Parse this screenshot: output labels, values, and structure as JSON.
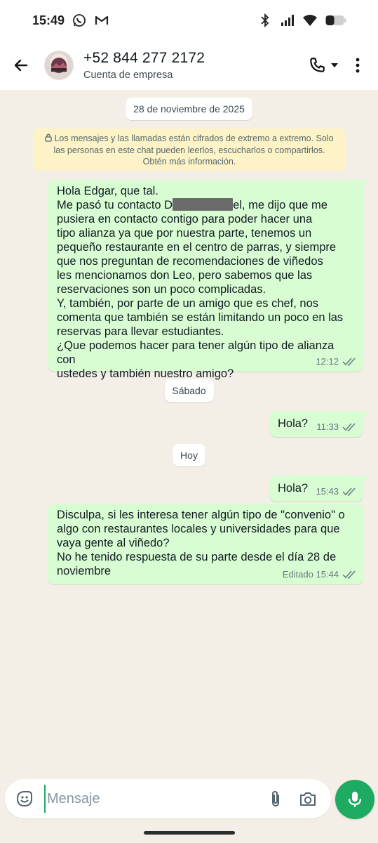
{
  "status_bar": {
    "time": "15:49",
    "left_icons": [
      "whatsapp-icon",
      "gmail-icon"
    ],
    "right_icons": [
      "bluetooth-icon",
      "signal-icon",
      "wifi-icon",
      "battery-icon"
    ]
  },
  "header": {
    "contact_name": "+52 844 277 2172",
    "contact_subtitle": "Cuenta de empresa",
    "icons": [
      "back-arrow-icon",
      "phone-icon",
      "chevron-down-icon",
      "more-vert-icon"
    ]
  },
  "chat": {
    "date_chip": "28 de noviembre de 2025",
    "encryption_notice": "Los mensajes y las llamadas están cifrados de extremo a extremo. Solo las personas en este chat pueden leerlos, escucharlos o compartirlos. Obtén más información.",
    "messages": [
      {
        "text_before": "Hola Edgar, que tal.\nMe pasó tu contacto D",
        "text_after": "el, me dijo que me\npusiera en contacto contigo para poder hacer una\ntipo alianza ya que por nuestra parte, tenemos un\npequeño restaurante en el centro de parras, y siempre\nque nos preguntan de recomendaciones de viñedos\nles mencionamos don Leo, pero sabemos que las\nreservaciones son un poco complicadas.\nY, también, por parte de un amigo que es chef, nos\ncomenta que también se están limitando un poco en las\nreservas para llevar estudiantes.\n¿Que podemos hacer para tener algún tipo de alianza con\nustedes y también nuestro amigo?",
        "time": "12:12",
        "status": "read-ticks"
      },
      {
        "day_chip": "Sábado"
      },
      {
        "text": "Hola?",
        "time": "11:33",
        "status": "read-ticks"
      },
      {
        "day_chip": "Hoy"
      },
      {
        "text": "Hola?",
        "time": "15:43",
        "status": "read-ticks"
      },
      {
        "text": "Disculpa, si les interesa tener algún tipo de \"convenio\" o\nalgo con restaurantes locales y universidades para que\nvaya gente al viñedo?\nNo he tenido respuesta de su parte desde el día 28 de\nnoviembre",
        "time": "Editado 15:44",
        "status": "read-ticks"
      }
    ]
  },
  "composer": {
    "placeholder": "Mensaje",
    "icons": [
      "sticker-icon",
      "attach-icon",
      "camera-icon",
      "mic-icon"
    ],
    "accent_color": "#1daa61"
  },
  "colors": {
    "background": "#f3efe6",
    "outgoing_bubble": "#d9fdd3",
    "notice_bg": "#fdf3c6",
    "accent": "#1daa61"
  }
}
